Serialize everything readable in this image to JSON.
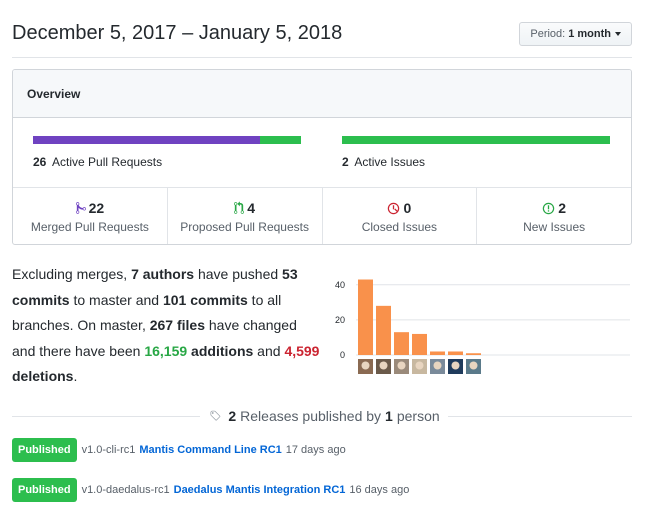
{
  "header": {
    "date_range": "December 5, 2017 – January 5, 2018",
    "period_label": "Period:",
    "period_value": "1 month"
  },
  "overview": {
    "title": "Overview",
    "pull_requests": {
      "count": "26",
      "label": "Active Pull Requests",
      "merged_fraction": 0.846,
      "merged_color": "#6f42c1",
      "open_color": "#2cbe4e"
    },
    "issues": {
      "count": "2",
      "label": "Active Issues",
      "closed_fraction": 0,
      "open_color": "#2cbe4e"
    },
    "stats": [
      {
        "icon": "git-merge-icon",
        "count": "22",
        "label": "Merged Pull Requests",
        "color": "#6f42c1"
      },
      {
        "icon": "git-pull-request-icon",
        "count": "4",
        "label": "Proposed Pull Requests",
        "color": "#28a745"
      },
      {
        "icon": "issue-closed-icon",
        "count": "0",
        "label": "Closed Issues",
        "color": "#cb2431"
      },
      {
        "icon": "issue-opened-icon",
        "count": "2",
        "label": "New Issues",
        "color": "#28a745"
      }
    ]
  },
  "summary": {
    "t1": "Excluding merges, ",
    "authors": "7 authors",
    "t2": " have pushed ",
    "commits_master": "53 commits",
    "t3": " to master and ",
    "commits_all": "101 commits",
    "t4": " to all branches. On master, ",
    "files": "267 files",
    "t5": " have changed and there have been ",
    "additions": "16,159",
    "additions_word": " additions",
    "t6": " and ",
    "deletions": "4,599",
    "deletions_word": " deletions",
    "t7": "."
  },
  "chart_data": {
    "type": "bar",
    "categories": [
      "author-1",
      "author-2",
      "author-3",
      "author-4",
      "author-5",
      "author-6",
      "author-7"
    ],
    "values": [
      43,
      28,
      13,
      12,
      2,
      2,
      1
    ],
    "ylim": [
      0,
      45
    ],
    "yticks": [
      "0",
      "20",
      "40"
    ],
    "bar_color": "#f9914b",
    "grid": true
  },
  "releases": {
    "count": "2",
    "t1": "Releases published by",
    "people": "1",
    "t2": "person",
    "items": [
      {
        "badge": "Published",
        "tag": "v1.0-cli-rc1",
        "name": "Mantis Command Line RC1",
        "time": "17 days ago"
      },
      {
        "badge": "Published",
        "tag": "v1.0-daedalus-rc1",
        "name": "Daedalus Mantis Integration RC1",
        "time": "16 days ago"
      }
    ]
  }
}
